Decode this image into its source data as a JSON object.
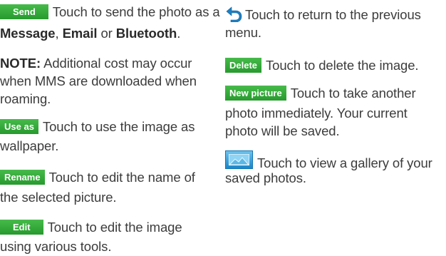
{
  "left": {
    "send": {
      "badge": "Send",
      "line1": "Touch to send the photo as a",
      "word1": "Message",
      "sep1": ", ",
      "word2": "Email",
      "sep2": " or ",
      "word3": "Bluetooth",
      "end": "."
    },
    "note": {
      "label": "NOTE:",
      "line1": " Additional cost may occur",
      "line2": "when MMS are downloaded when",
      "line3": "roaming."
    },
    "use_as": {
      "badge": "Use as",
      "line1": "Touch to use the image as",
      "line2": "wallpaper."
    },
    "rename": {
      "badge": "Rename",
      "line1": "Touch to edit the name of",
      "line2": "the selected picture."
    },
    "edit": {
      "badge": "Edit",
      "line1": "Touch to edit the image",
      "line2": "using various tools."
    }
  },
  "right": {
    "back": {
      "icon": "back-arrow-icon",
      "line1": "Touch to return to the previous",
      "line2": "menu."
    },
    "delete": {
      "badge": "Delete",
      "line1": "Touch to delete the image."
    },
    "new_picture": {
      "badge": "New picture",
      "line1": "Touch to take another",
      "line2": "photo immediately. Your current",
      "line3": "photo will be saved."
    },
    "gallery": {
      "icon": "gallery-icon",
      "line1": "Touch to view a gallery of your",
      "line2": "saved photos."
    }
  },
  "colors": {
    "badge_green": "#34a93a",
    "back_icon_blue": "#1e7fc0",
    "gallery_icon_blue": "#2a95d4",
    "text": "#3c3c3c"
  }
}
